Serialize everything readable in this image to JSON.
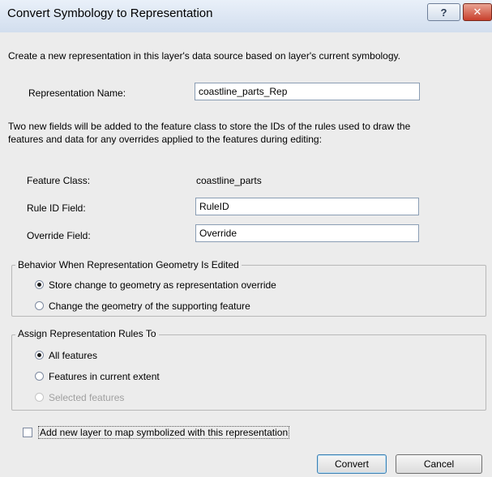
{
  "window": {
    "title": "Convert Symbology to Representation",
    "help_glyph": "?",
    "close_glyph": "✕"
  },
  "intro": "Create a new representation in this layer's data source based on layer's current symbology.",
  "rep_name": {
    "label": "Representation Name:",
    "value": "coastline_parts_Rep"
  },
  "fields_note": {
    "line1": "Two new fields will be added to the feature class to store the IDs of the rules used to draw the",
    "line2": "features and data for any overrides applied to the features during editing:"
  },
  "feature_class": {
    "label": "Feature Class:",
    "value": "coastline_parts"
  },
  "rule_id": {
    "label": "Rule ID Field:",
    "value": "RuleID"
  },
  "override": {
    "label": "Override Field:",
    "value": "Override"
  },
  "behavior": {
    "legend": "Behavior When Representation Geometry Is Edited",
    "options": [
      {
        "label": "Store change to geometry as representation override",
        "checked": true
      },
      {
        "label": "Change the geometry of the supporting feature",
        "checked": false
      }
    ]
  },
  "assign": {
    "legend": "Assign Representation Rules To",
    "options": [
      {
        "label": "All features",
        "checked": true,
        "enabled": true
      },
      {
        "label": "Features in current extent",
        "checked": false,
        "enabled": true
      },
      {
        "label": "Selected features",
        "checked": false,
        "enabled": false
      }
    ]
  },
  "add_layer": {
    "label": "Add new layer to map symbolized with this representation",
    "checked": false
  },
  "buttons": {
    "convert": "Convert",
    "cancel": "Cancel"
  }
}
